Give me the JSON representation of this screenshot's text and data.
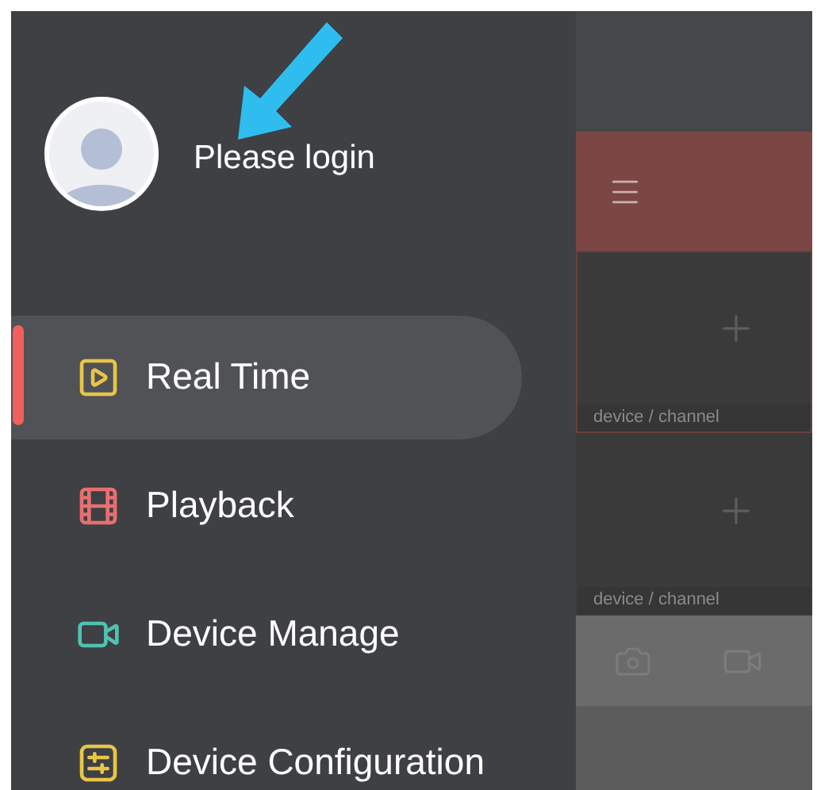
{
  "user": {
    "label": "Please login"
  },
  "menu": [
    {
      "label": "Real Time",
      "kind": "play",
      "color": "#e8c547",
      "selected": true
    },
    {
      "label": "Playback",
      "kind": "film",
      "color": "#e86f6f",
      "selected": false
    },
    {
      "label": "Device Manage",
      "kind": "camera",
      "color": "#4fc3b0",
      "selected": false
    },
    {
      "label": "Device Configuration",
      "kind": "sliders",
      "color": "#e8c547",
      "selected": false
    }
  ],
  "preview": {
    "tiles": [
      {
        "label": "device / channel",
        "selected": true
      },
      {
        "label": "device / channel",
        "selected": false
      }
    ]
  }
}
